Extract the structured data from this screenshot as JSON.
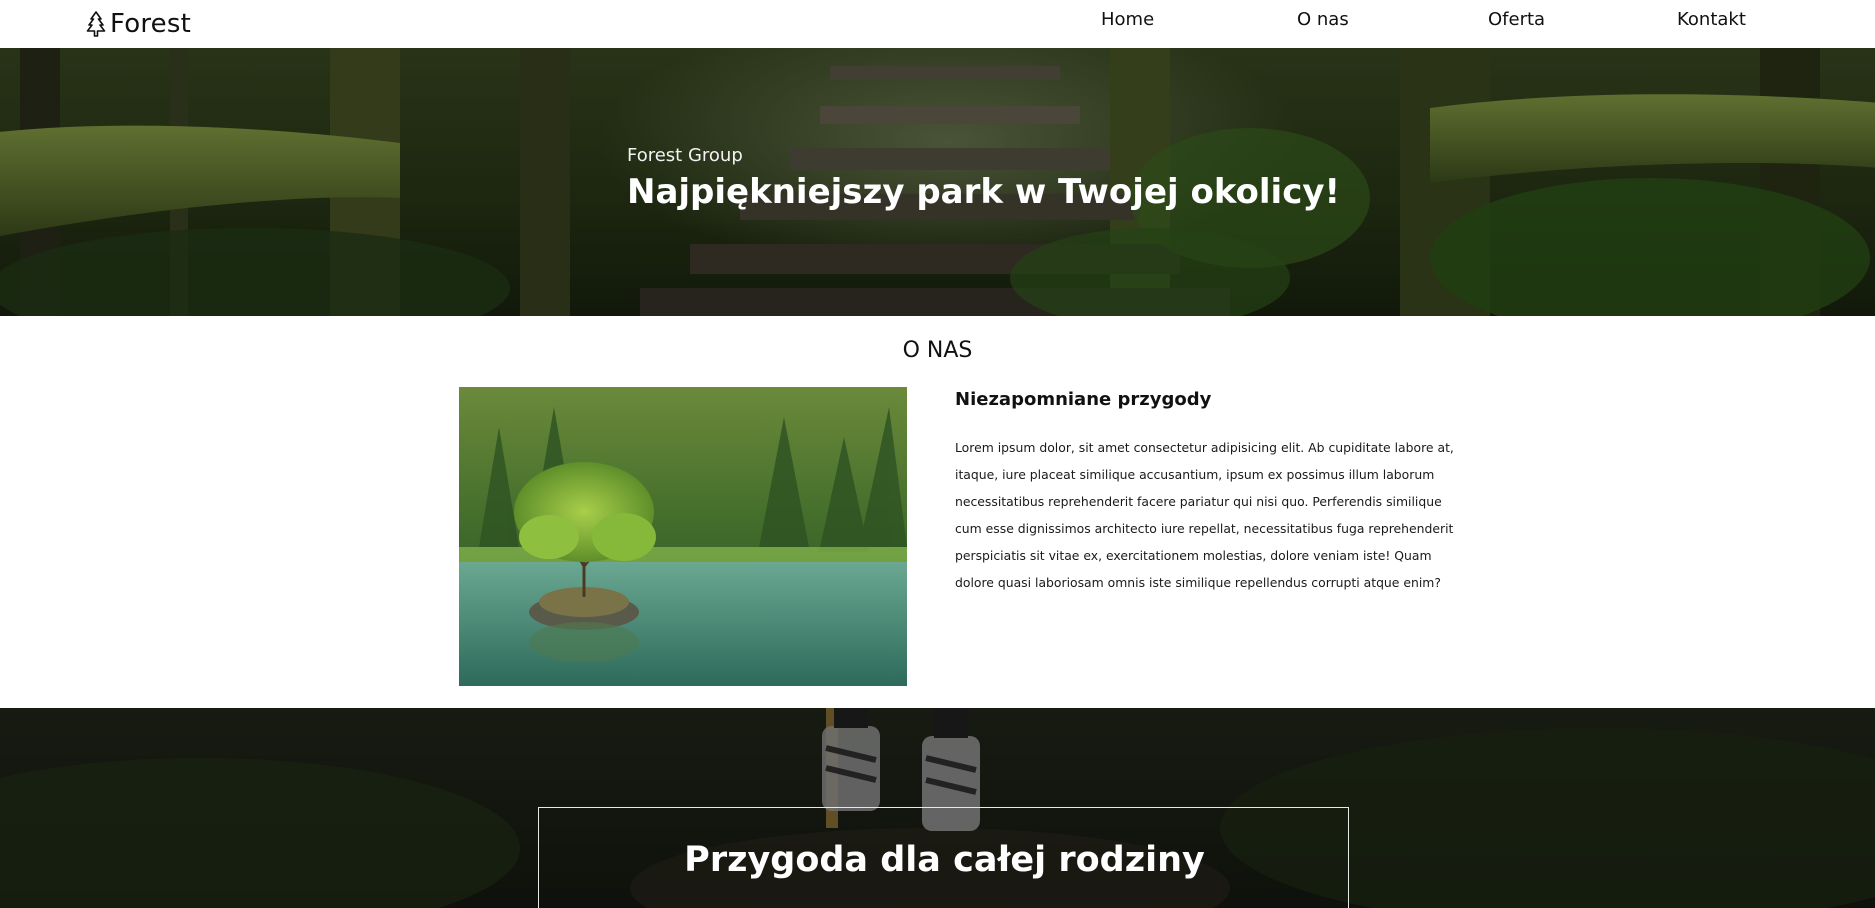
{
  "nav": {
    "logo_text": "Forest",
    "links": [
      "Home",
      "O nas",
      "Oferta",
      "Kontakt"
    ]
  },
  "hero": {
    "subtitle": "Forest Group",
    "title": "Najpiękniejszy park w Twojej okolicy!"
  },
  "about": {
    "heading": "O NAS",
    "title": "Niezapomniane przygody",
    "text": "Lorem ipsum dolor, sit amet consectetur adipisicing elit. Ab cupiditate labore at, itaque, iure placeat similique accusantium, ipsum ex possimus illum laborum necessitatibus reprehenderit facere pariatur qui nisi quo. Perferendis similique cum esse dignissimos architecto iure repellat, necessitatibus fuga reprehenderit perspiciatis sit vitae ex, exercitationem molestias, dolore veniam iste! Quam dolore quasi laboriosam omnis iste similique repellendus corrupti atque enim?"
  },
  "family": {
    "title": "Przygoda dla całej rodziny"
  },
  "icons": {
    "logo": "tree-icon"
  },
  "colors": {
    "nav_bg": "#ffffff",
    "hero_overlay": "#000000",
    "text_dark": "#111111",
    "text_light": "#ffffff"
  }
}
